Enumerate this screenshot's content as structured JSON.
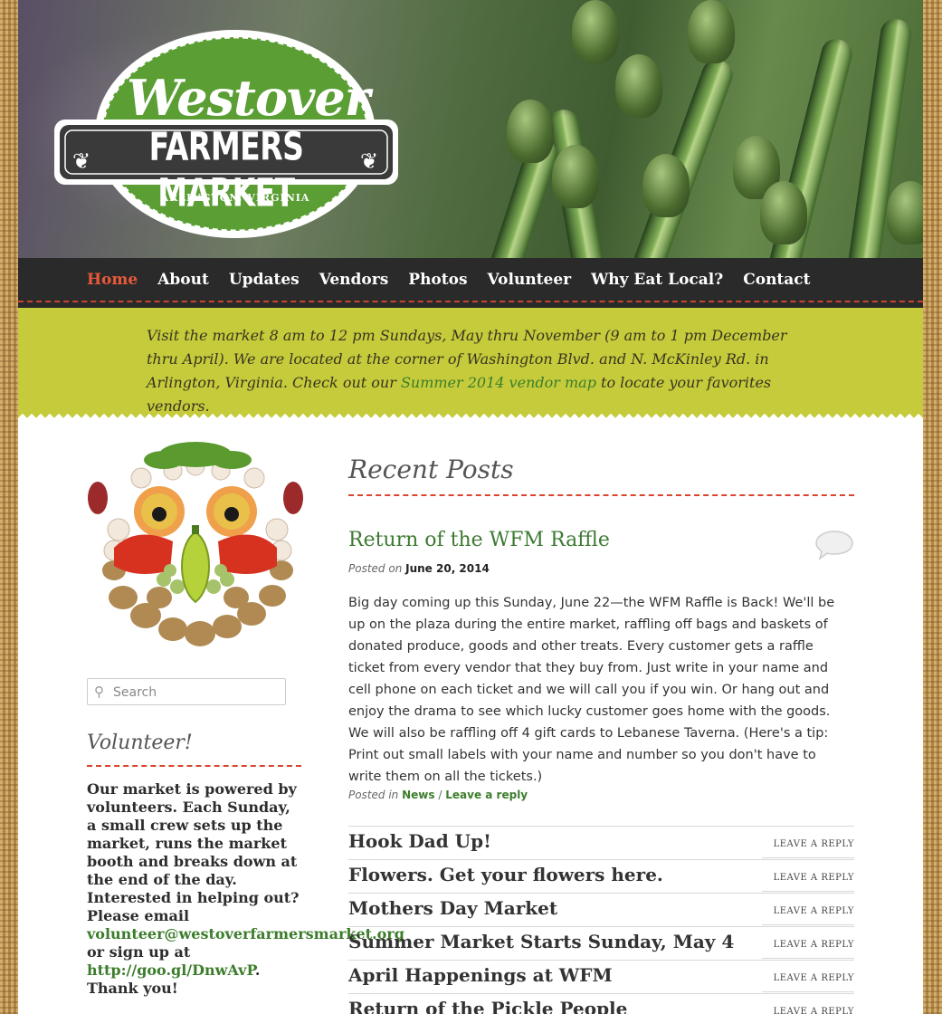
{
  "header": {
    "logo_script": "Westover",
    "logo_banner": "FARMERS MARKET",
    "logo_location": "ARLINGTON, VIRGINIA"
  },
  "nav": {
    "items": [
      {
        "label": "Home",
        "active": true
      },
      {
        "label": "About"
      },
      {
        "label": "Updates"
      },
      {
        "label": "Vendors"
      },
      {
        "label": "Photos"
      },
      {
        "label": "Volunteer"
      },
      {
        "label": "Why Eat Local?"
      },
      {
        "label": "Contact"
      }
    ]
  },
  "notice": {
    "text_before": "Visit the market 8 am to 12 pm Sundays, May thru November (9 am to 1 pm December thru April).  We are located at the corner of Washington Blvd. and N. McKinley Rd. in Arlington, Virginia. Check out our ",
    "link": "Summer 2014 vendor map",
    "text_after": " to locate your favorites vendors."
  },
  "sidebar": {
    "search_placeholder": "Search",
    "volunteer_title": "Volunteer!",
    "volunteer_text_1": "Our market is powered by volunteers. Each Sunday, a small crew sets up the market, runs the market booth and breaks down at the end of the day. Interested in helping out? Please email ",
    "volunteer_email": "volunteer@westoverfarmersmarket.org",
    "volunteer_text_2": " or sign up at ",
    "volunteer_link": "http://goo.gl/DnwAvP",
    "volunteer_text_3": ". Thank you!"
  },
  "main": {
    "section_title": "Recent Posts",
    "post": {
      "title": "Return of the WFM Raffle",
      "posted_on_label": "Posted on",
      "date": "June 20, 2014",
      "body": "Big day coming up this Sunday, June 22—the WFM Raffle is Back! We'll be up on the plaza during the entire market, raffling off bags and baskets of donated produce, goods and other treats. Every customer gets a raffle ticket from every vendor that they buy from. Just write in your name and cell phone on each ticket and we will call you if you win. Or hang out and enjoy the drama to see which lucky customer goes home with the goods. We will also be raffling off 4 gift cards to Lebanese Taverna. (Here's a tip: Print out small labels with your name and number so you don't have to write them on all the tickets.)",
      "posted_in_label": "Posted in",
      "category": "News",
      "separator": "/",
      "reply_link": "Leave a reply"
    },
    "list": [
      {
        "title": "Hook Dad Up!",
        "reply": "LEAVE A REPLY"
      },
      {
        "title": "Flowers. Get your flowers here.",
        "reply": "LEAVE A REPLY"
      },
      {
        "title": "Mothers Day Market",
        "reply": "LEAVE A REPLY"
      },
      {
        "title": "Summer Market Starts Sunday, May 4",
        "reply": "LEAVE A REPLY"
      },
      {
        "title": "April Happenings at WFM",
        "reply": "LEAVE A REPLY"
      },
      {
        "title": "Return of the Pickle People",
        "reply": "LEAVE A REPLY"
      }
    ]
  },
  "colors": {
    "accent_green": "#3b7d2b",
    "nav_active": "#e8593a",
    "notice_bg": "#c5cb3b",
    "dash_red": "#d9452f"
  }
}
